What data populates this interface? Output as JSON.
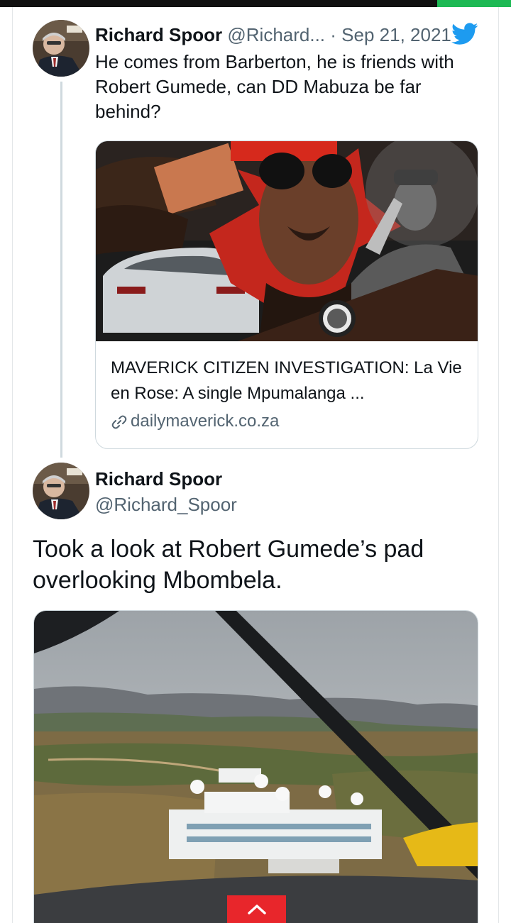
{
  "tweet_reply_context": {
    "author_name": "Richard Spoor",
    "author_handle": "@Richard...",
    "separator": "·",
    "date": "Sep 21, 2021",
    "text": "He comes from Barberton, he is friends with Robert Gumede, can DD Mabuza be far behind?",
    "avatar_icon": "person-avatar-icon",
    "brand_icon": "twitter-bird-icon",
    "link_card": {
      "title": "MAVERICK CITIZEN INVESTIGATION: La Vie en Rose: A single Mpumalanga ...",
      "domain": "dailymaverick.co.za",
      "domain_icon": "link-icon"
    }
  },
  "tweet_main": {
    "author_name": "Richard Spoor",
    "author_handle": "@Richard_Spoor",
    "text": "Took a look at Robert Gumede’s pad overlooking Mbombela.",
    "avatar_icon": "person-avatar-icon"
  },
  "ui": {
    "scroll_top_icon": "chevron-up-icon"
  },
  "colors": {
    "twitter_blue": "#1d9bf0",
    "muted_text": "#536471",
    "scroll_button": "#e8262b",
    "top_accent": "#1db954"
  }
}
